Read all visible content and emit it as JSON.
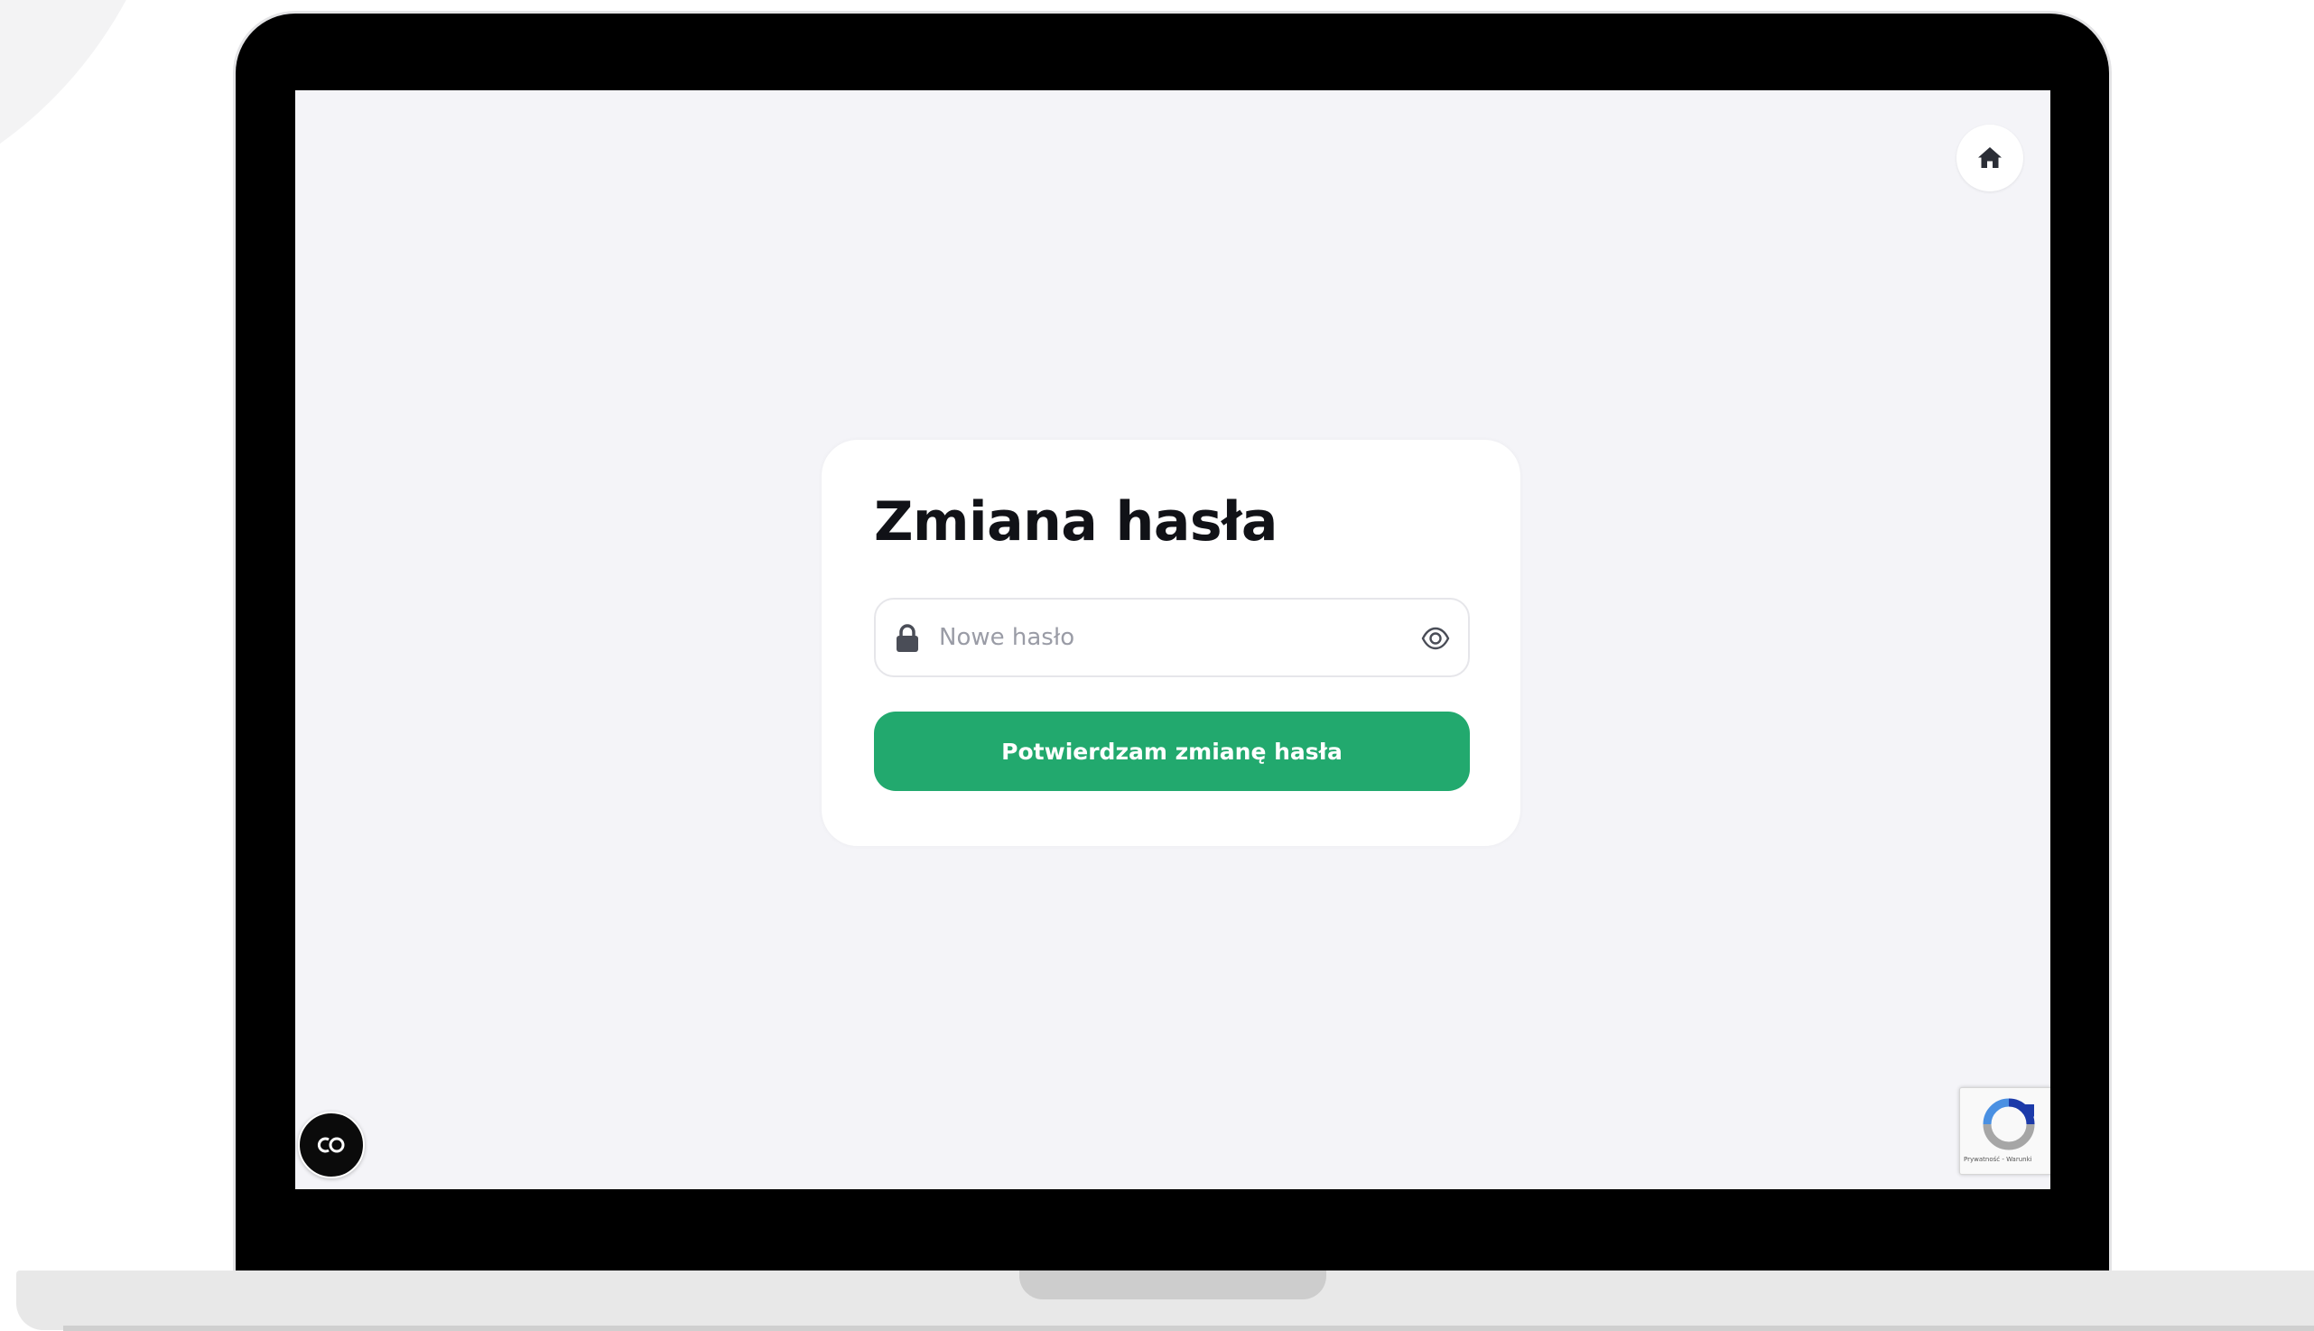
{
  "page": {
    "title": "Zmiana hasła"
  },
  "form": {
    "password_placeholder": "Nowe hasło",
    "password_value": "",
    "submit_label": "Potwierdzam zmianę hasła"
  },
  "icons": {
    "home": "home-icon",
    "lock": "lock-icon",
    "eye": "eye-icon",
    "cookie": "cookie-settings-icon",
    "recaptcha": "recaptcha-icon"
  },
  "recaptcha": {
    "links": "Prywatność - Warunki"
  },
  "colors": {
    "accent": "#22a96e",
    "screen_background": "#f4f4f8",
    "title": "#111217",
    "placeholder": "#9a9ca6",
    "icon": "#4a4d57"
  }
}
